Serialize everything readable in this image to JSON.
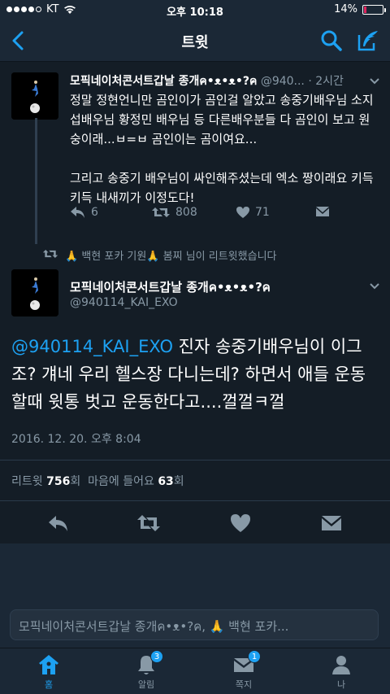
{
  "status_bar": {
    "carrier": "KT",
    "time": "오후 10:18",
    "battery_text": "14%",
    "battery_level": 0.14,
    "battery_color": "#e0245e"
  },
  "nav": {
    "title": "트윗",
    "back_icon": "chevron-left-icon",
    "search_icon": "search-icon",
    "compose_icon": "compose-quill-icon"
  },
  "reply_tweet": {
    "name": "모픽네이처콘서트갑날 종개ค•ᴥ•ᴥ•?ค",
    "handle": "@940...",
    "time": "· 2시간",
    "body": "정말 정현언니만 곰인이가 곰인걸 알았고 송중기배우님 소지섭배우님 황정민 배우님 등 다른배우분들 다 곰인이 보고 원숭이래...ㅂ=ㅂ 곰인이는 곰이여요...\n\n그리고 송중기 배우님이 싸인해주셨는데 엑소 짱이래요 키득키득 내새끼가 이정도다!",
    "reply_count": "6",
    "retweet_count": "808",
    "like_count": "71"
  },
  "retweet_notice": {
    "text": "🙏 백현 포카 기원🙏 봄찌 님이 리트윗했습니다"
  },
  "main_tweet": {
    "name": "모픽네이처콘서트갑날 종개ค•ᴥ•ᴥ•?ค",
    "handle": "@940114_KAI_EXO",
    "mention": "@940114_KAI_EXO",
    "body": " 진자 송중기배우님이 이그조? 걔네 우리 헬스장 다니는데? 하면서 애들 운동할때 윗통 벗고 운동한다고....껄껄ㅋ껄",
    "date": "2016. 12. 20. 오후 8:04",
    "retweet_label": "리트윗",
    "retweet_count": "756",
    "retweet_unit": "회",
    "like_label": "마음에 들어요",
    "like_count": "63",
    "like_unit": "회"
  },
  "reply_box": {
    "placeholder": "모픽네이처콘서트갑날 종개ค•ᴥ•?ค, 🙏 백현 포카..."
  },
  "tabbar": {
    "tabs": [
      {
        "label": "홈",
        "icon": "home-icon",
        "active": true
      },
      {
        "label": "알림",
        "icon": "bell-icon",
        "badge": "3"
      },
      {
        "label": "쪽지",
        "icon": "envelope-icon",
        "badge": "1"
      },
      {
        "label": "나",
        "icon": "person-icon"
      }
    ]
  },
  "colors": {
    "accent": "#1da1f2",
    "background": "#141d26",
    "bar": "#1b2836",
    "muted": "#8899a6"
  }
}
